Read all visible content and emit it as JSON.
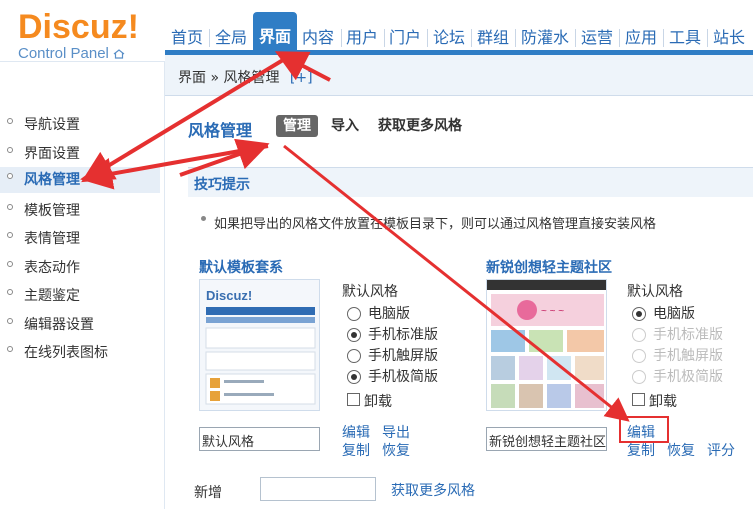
{
  "logo": {
    "brand": "Discuz!",
    "sub": "Control Panel"
  },
  "topnav": [
    "首页",
    "全局",
    "界面",
    "内容",
    "用户",
    "门户",
    "论坛",
    "群组",
    "防灌水",
    "运营",
    "应用",
    "工具",
    "站长"
  ],
  "breadcrumb": {
    "path": "界面 » 风格管理",
    "add": "[+]"
  },
  "sidebar": [
    "导航设置",
    "界面设置",
    "风格管理",
    "模板管理",
    "表情管理",
    "表态动作",
    "主题鉴定",
    "编辑器设置",
    "在线列表图标"
  ],
  "page": {
    "title": "风格管理",
    "tabs": [
      "管理",
      "导入",
      "获取更多风格"
    ],
    "tips_title": "技巧提示",
    "tip": "如果把导出的风格文件放置在模板目录下，则可以通过风格管理直接安装风格"
  },
  "themes": [
    {
      "title": "默认模板套系",
      "group_label": "默认风格",
      "options": [
        "电脑版",
        "手机标准版",
        "手机触屏版",
        "手机极简版"
      ],
      "uninstall": "卸载",
      "name": "默认风格",
      "links": [
        "编辑",
        "导出",
        "复制",
        "恢复"
      ]
    },
    {
      "title": "新锐创想轻主题社区",
      "group_label": "默认风格",
      "options": [
        "电脑版",
        "手机标准版",
        "手机触屏版",
        "手机极简版"
      ],
      "uninstall": "卸载",
      "name": "新锐创想轻主题社区",
      "links": [
        "编辑",
        "复制",
        "恢复",
        "评分"
      ]
    }
  ],
  "new_row": {
    "label": "新增",
    "link": "获取更多风格"
  },
  "colors": {
    "nav_active": "#2f7dc5",
    "link": "#2a6bb5",
    "logo": "#f58a1f",
    "annotation_arrow": "#e53030"
  }
}
